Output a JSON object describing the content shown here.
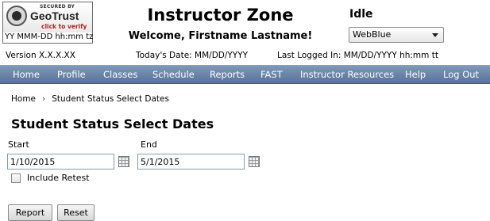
{
  "seal": {
    "secured_by": "SECURED BY",
    "brand": "GeoTrust",
    "verify": "click to verify",
    "date": "YY MMM-DD hh:mm tz"
  },
  "header": {
    "title": "Instructor Zone",
    "welcome": "Welcome, Firstname Lastname!",
    "status": "Idle",
    "theme_selected": "WebBlue"
  },
  "info": {
    "version": "Version X.X.X.XX",
    "todays_date": "Today's Date: MM/DD/YYYY",
    "last_logged": "Last Logged In: MM/DD/YYYY hh:mm tt"
  },
  "nav": [
    "Home",
    "Profile",
    "Classes",
    "Schedule",
    "Reports",
    "FAST",
    "Instructor Resources",
    "Help",
    "Log Out"
  ],
  "breadcrumb": {
    "home": "Home",
    "separator": "›",
    "current": "Student Status Select Dates"
  },
  "page_title": "Student Status Select Dates",
  "form": {
    "start_label": "Start",
    "start_value": "1/10/2015",
    "end_label": "End",
    "end_value": "5/1/2015",
    "include_retest_label": "Include Retest",
    "include_retest_checked": false,
    "report_button": "Report",
    "reset_button": "Reset"
  }
}
